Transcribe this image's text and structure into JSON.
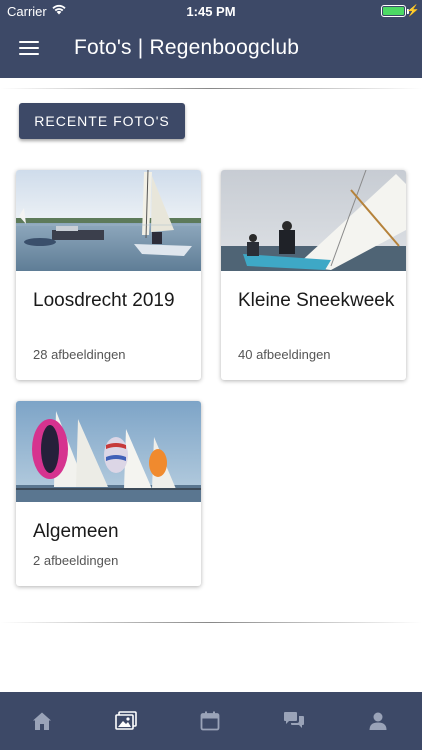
{
  "status_bar": {
    "carrier": "Carrier",
    "time": "1:45 PM"
  },
  "header": {
    "title": "Foto's | Regenboogclub"
  },
  "recent_button": {
    "label": "RECENTE FOTO'S"
  },
  "albums": [
    {
      "title": "Loosdrecht 2019",
      "count": "28 afbeeldingen"
    },
    {
      "title": "Kleine Sneekweek",
      "count": "40 afbeeldingen"
    },
    {
      "title": "Algemeen",
      "count": "2 afbeeldingen"
    }
  ],
  "tabs": [
    {
      "icon": "home-icon"
    },
    {
      "icon": "photos-icon"
    },
    {
      "icon": "calendar-icon"
    },
    {
      "icon": "chat-icon"
    },
    {
      "icon": "profile-icon"
    }
  ],
  "colors": {
    "primary": "#3d4967",
    "battery": "#4cd964",
    "active_icon": "#ffffff",
    "inactive_icon": "#9aa3b8"
  }
}
